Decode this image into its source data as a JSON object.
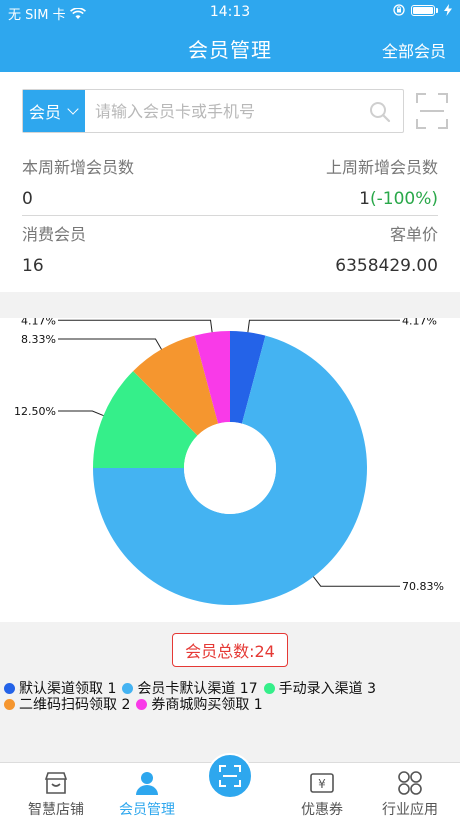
{
  "status_bar": {
    "carrier": "无 SIM 卡",
    "time": "14:13"
  },
  "nav": {
    "title": "会员管理",
    "right_action": "全部会员"
  },
  "search": {
    "type_label": "会员",
    "placeholder": "请输入会员卡或手机号",
    "value": ""
  },
  "stats": {
    "new_this_week_label": "本周新增会员数",
    "new_last_week_label": "上周新增会员数",
    "new_this_week_value": "0",
    "new_last_week_value": "1",
    "new_last_week_change": "(-100%)",
    "consuming_members_label": "消费会员",
    "avg_order_label": "客单价",
    "consuming_members_value": "16",
    "avg_order_value": "6358429.00"
  },
  "chart_data": {
    "type": "pie",
    "donut": true,
    "series": [
      {
        "name": "默认渠道领取",
        "value": 1,
        "percent_label": "4.17%",
        "color": "#2463e8"
      },
      {
        "name": "会员卡默认渠道",
        "value": 17,
        "percent_label": "70.83%",
        "color": "#44b3f2"
      },
      {
        "name": "手动录入渠道",
        "value": 3,
        "percent_label": "12.50%",
        "color": "#35ef8a"
      },
      {
        "name": "二维码扫码领取",
        "value": 2,
        "percent_label": "8.33%",
        "color": "#f5962f"
      },
      {
        "name": "券商城购买领取",
        "value": 1,
        "percent_label": "4.17%",
        "color": "#f93ae8"
      }
    ]
  },
  "total": {
    "label": "会员总数:24"
  },
  "legend": [
    {
      "text": "默认渠道领取 1",
      "color": "#2463e8"
    },
    {
      "text": "会员卡默认渠道 17",
      "color": "#44b3f2"
    },
    {
      "text": "手动录入渠道 3",
      "color": "#35ef8a"
    },
    {
      "text": "二维码扫码领取 2",
      "color": "#f5962f"
    },
    {
      "text": "券商城购买领取 1",
      "color": "#f93ae8"
    }
  ],
  "tabs": [
    {
      "label": "智慧店铺"
    },
    {
      "label": "会员管理"
    },
    {
      "label": "优惠券"
    },
    {
      "label": "行业应用"
    }
  ],
  "colors": {
    "primary": "#2ea7ee",
    "danger": "#e53935",
    "success": "#2aa84a"
  }
}
